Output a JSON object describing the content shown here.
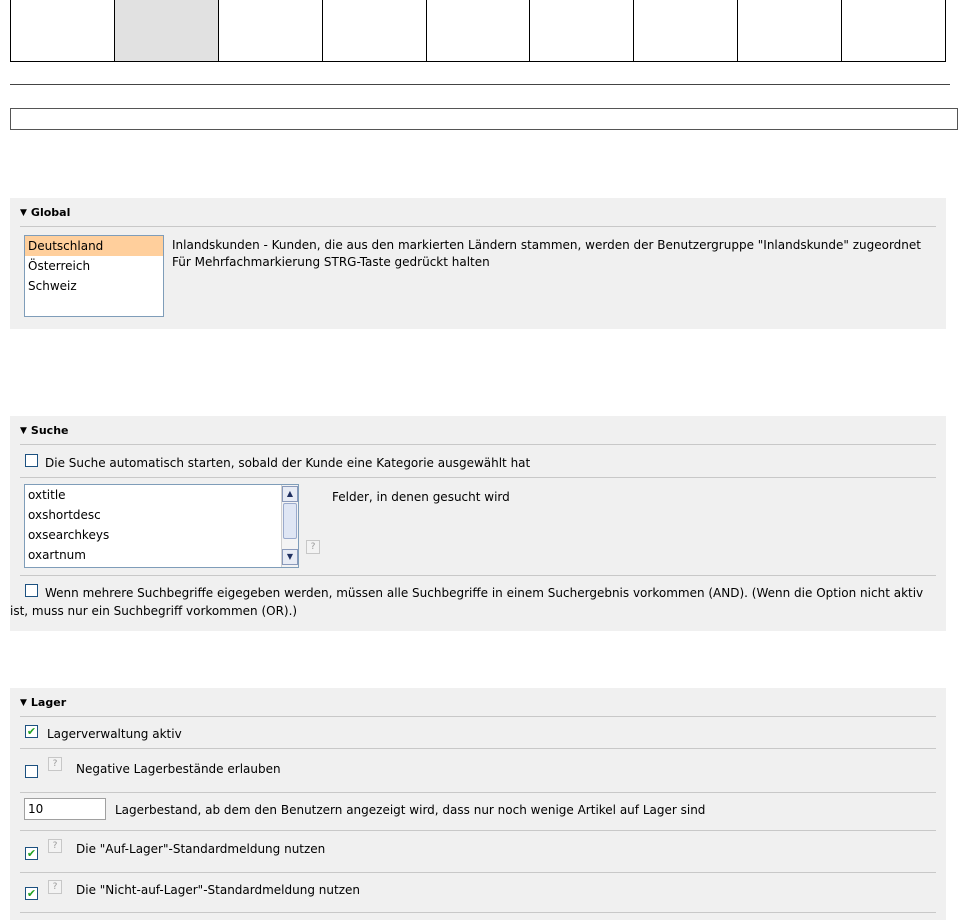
{
  "global": {
    "title": "Global",
    "countries": [
      "Deutschland",
      "Österreich",
      "Schweiz"
    ],
    "selected_country": "Deutschland",
    "desc_line1": "Inlandskunden - Kunden, die aus den markierten Ländern stammen, werden der Benutzergruppe \"Inlandskunde\" zugeordnet",
    "desc_line2": "Für Mehrfachmarkierung STRG-Taste gedrückt halten"
  },
  "suche": {
    "title": "Suche",
    "autostart_label": "Die Suche automatisch starten, sobald der Kunde eine Kategorie ausgewählt hat",
    "fields": [
      "oxtitle",
      "oxshortdesc",
      "oxsearchkeys",
      "oxartnum"
    ],
    "fields_label": "Felder, in denen gesucht wird",
    "and_label_line1": "Wenn mehrere Suchbegriffe eigegeben werden, müssen alle Suchbegriffe in einem Suchergebnis vorkommen (AND). (Wenn die Option nicht aktiv",
    "and_label_line2": "ist, muss nur ein Suchbegriff vorkommen (OR).)",
    "help_glyph": "?"
  },
  "lager": {
    "title": "Lager",
    "lagerverwaltung_label": "Lagerverwaltung aktiv",
    "lagerverwaltung_checked": true,
    "negative_label": "Negative Lagerbestände erlauben",
    "negative_checked": false,
    "threshold_value": "10",
    "threshold_label": "Lagerbestand, ab dem den Benutzern angezeigt wird, dass nur noch wenige Artikel auf Lager sind",
    "auf_lager_label": "Die \"Auf-Lager\"-Standardmeldung nutzen",
    "auf_lager_checked": true,
    "nicht_auf_lager_label": "Die \"Nicht-auf-Lager\"-Standardmeldung nutzen",
    "nicht_auf_lager_checked": true,
    "help_glyph": "?"
  },
  "check_glyph": "✔",
  "caret_glyph": "▼"
}
